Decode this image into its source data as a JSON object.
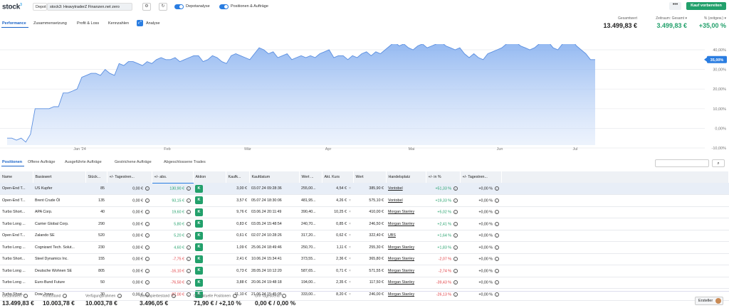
{
  "header": {
    "logo": "stock",
    "logo_sup": "3",
    "depot_label": "Depot",
    "depot_value": "stock3: HeavytraderZ Finanzen.net zero",
    "toggle_depotanalyse": "Depotanalyse",
    "toggle_positionen": "Positionen & Aufträge",
    "more_label": "•••",
    "buy_label": "Kauf vorbereiten"
  },
  "tabs": [
    {
      "label": "Performance",
      "active": true
    },
    {
      "label": "Zusammensetzung",
      "active": false
    },
    {
      "label": "Profit & Loss",
      "active": false
    },
    {
      "label": "Kennzahlen",
      "active": false
    },
    {
      "label": "Analyse",
      "active": false
    }
  ],
  "kpis": {
    "gesamtwert_label": "Gesamtwert",
    "gesamtwert_value": "13.499,83 €",
    "zeitraum_label": "Zeitraum: Gesamt ▾",
    "zeitraum_value": "3.499,83 €",
    "pct_label": "% (zeitgew.) ▾",
    "pct_value": "+35,00 %"
  },
  "chart_data": {
    "type": "area",
    "x_labels": [
      "Jan '24",
      "Feb",
      "Mär",
      "Apr",
      "Mai",
      "Jun",
      "Jul"
    ],
    "y_ticks": [
      "40,00%",
      "30,00%",
      "20,00%",
      "10,00%",
      "0,00%",
      "-10,00%"
    ],
    "ylim": [
      -10,
      40
    ],
    "current_label": "35,00%",
    "accent": "#2a7de1",
    "values": [
      -5,
      -5,
      -6,
      -5,
      -7,
      -3,
      10,
      10,
      10,
      10,
      11,
      11,
      18,
      18,
      19,
      20,
      26,
      27,
      28,
      28,
      27,
      30,
      28,
      27,
      33,
      32,
      34,
      34,
      33,
      32,
      34,
      33,
      35,
      36,
      35,
      35,
      36,
      34,
      35,
      36,
      37,
      37,
      34,
      35,
      37,
      36,
      34,
      33,
      37,
      38,
      37,
      36,
      35,
      38,
      41,
      40,
      38,
      39,
      36,
      37,
      38,
      35,
      36,
      37,
      36,
      37,
      36,
      38,
      39,
      40,
      36,
      37,
      37,
      35,
      37,
      36,
      38,
      39,
      37,
      39,
      38,
      40,
      42,
      44,
      42,
      43,
      41,
      40,
      42,
      43,
      41,
      42,
      43,
      44,
      42,
      41,
      40,
      41,
      38,
      36,
      38,
      36,
      35,
      38,
      39,
      40,
      41,
      43,
      45,
      44,
      42,
      41,
      40,
      41,
      43,
      46,
      44,
      41,
      40,
      43,
      44,
      45,
      42,
      40,
      38,
      35,
      35
    ]
  },
  "tabs2": [
    {
      "label": "Positionen",
      "active": true
    },
    {
      "label": "Offene Aufträge",
      "active": false
    },
    {
      "label": "Ausgeführte Aufträge",
      "active": false
    },
    {
      "label": "Gestrichene Aufträge",
      "active": false
    },
    {
      "label": "Abgeschlossene Trades",
      "active": false
    }
  ],
  "search_icon": "search-icon",
  "table": {
    "headers": [
      "Name",
      "Basiswert",
      "Stück...",
      "+/- Tagestren...",
      "+/- abs.",
      "Aktion",
      "Kaufk...",
      "Kaufdatum",
      "Wert ...",
      "Akt. Kurs",
      "Wert",
      "Handelsplatz",
      "+/- in %",
      "+/- Tagestren..."
    ],
    "rows": [
      {
        "name": "Open-End T...",
        "base": "US Kupfer",
        "qty": "85",
        "tag": "0,00 €",
        "abs": "130,90 €",
        "abs_pos": true,
        "kauf": "3,00 €",
        "datum": "03.07.24 09:28:36",
        "wert1": "255,00...",
        "kurs": "4,54 €",
        "wert": "385,90 €",
        "platz": "Vontobel",
        "pct": "+51,33 %",
        "pct_pos": true,
        "tag2": "+0,00 %"
      },
      {
        "name": "Open-End T...",
        "base": "Brent Crude Öl",
        "qty": "135",
        "tag": "0,00 €",
        "abs": "93,15 €",
        "abs_pos": true,
        "kauf": "3,57 €",
        "datum": "05.07.24 18:30:06",
        "wert1": "481,95...",
        "kurs": "4,26 €",
        "wert": "575,10 €",
        "platz": "Vontobel",
        "pct": "+19,33 %",
        "pct_pos": true,
        "tag2": "+0,00 %"
      },
      {
        "name": "Turbo Short...",
        "base": "APA Corp.",
        "qty": "40",
        "tag": "0,00 €",
        "abs": "19,60 €",
        "abs_pos": true,
        "kauf": "9,76 €",
        "datum": "03.06.24 20:11:49",
        "wert1": "390,40...",
        "kurs": "10,25 €",
        "wert": "410,00 €",
        "platz": "Morgan Stanley",
        "pct": "+5,02 %",
        "pct_pos": true,
        "tag2": "+0,00 %"
      },
      {
        "name": "Turbo Long ...",
        "base": "Carrier Global Corp.",
        "qty": "290",
        "tag": "0,00 €",
        "abs": "5,80 €",
        "abs_pos": true,
        "kauf": "0,83 €",
        "datum": "03.05.24 15:48:54",
        "wert1": "240,70...",
        "kurs": "0,85 €",
        "wert": "246,50 €",
        "platz": "Morgan Stanley",
        "pct": "+2,41 %",
        "pct_pos": true,
        "tag2": "+0,00 %"
      },
      {
        "name": "Open End T...",
        "base": "Zalando SE",
        "qty": "520",
        "tag": "0,00 €",
        "abs": "5,20 €",
        "abs_pos": true,
        "kauf": "0,61 €",
        "datum": "02.07.24 10:28:26",
        "wert1": "317,20...",
        "kurs": "0,62 €",
        "wert": "322,40 €",
        "platz": "UBS",
        "pct": "+1,64 %",
        "pct_pos": true,
        "tag2": "+0,00 %"
      },
      {
        "name": "Turbo Long ...",
        "base": "Cognizant Tech. Solut...",
        "qty": "230",
        "tag": "0,00 €",
        "abs": "4,60 €",
        "abs_pos": true,
        "kauf": "1,09 €",
        "datum": "25.06.24 18:49:46",
        "wert1": "250,70...",
        "kurs": "1,11 €",
        "wert": "255,30 €",
        "platz": "Morgan Stanley",
        "pct": "+1,83 %",
        "pct_pos": true,
        "tag2": "+0,00 %"
      },
      {
        "name": "Turbo Short...",
        "base": "Steel Dynamics Inc.",
        "qty": "155",
        "tag": "0,00 €",
        "abs": "-7,75 €",
        "abs_pos": false,
        "kauf": "2,41 €",
        "datum": "10.06.24 15:34:41",
        "wert1": "373,55...",
        "kurs": "2,36 €",
        "wert": "365,80 €",
        "platz": "Morgan Stanley",
        "pct": "-2,07 %",
        "pct_pos": false,
        "tag2": "+0,00 %"
      },
      {
        "name": "Turbo Long ...",
        "base": "Deutsche Wohnen SE",
        "qty": "805",
        "tag": "0,00 €",
        "abs": "-16,10 €",
        "abs_pos": false,
        "kauf": "0,73 €",
        "datum": "28.05.24 10:12:20",
        "wert1": "587,65...",
        "kurs": "0,71 €",
        "wert": "571,55 €",
        "platz": "Morgan Stanley",
        "pct": "-2,74 %",
        "pct_pos": false,
        "tag2": "+0,00 %"
      },
      {
        "name": "Turbo Long ...",
        "base": "Euro-Bund Future",
        "qty": "50",
        "tag": "0,00 €",
        "abs": "-76,50 €",
        "abs_pos": false,
        "kauf": "3,88 €",
        "datum": "20.06.24 19:48:18",
        "wert1": "194,00...",
        "kurs": "2,35 €",
        "wert": "117,50 €",
        "platz": "Morgan Stanley",
        "pct": "-39,43 %",
        "pct_pos": false,
        "tag2": "+0,00 %"
      },
      {
        "name": "Turbo Short...",
        "base": "Dow Jones",
        "qty": "30",
        "tag": "0,00 €",
        "abs": "-87,00 €",
        "abs_pos": false,
        "kauf": "11,10 €",
        "datum": "21.06.24 15:45:05",
        "wert1": "333,00...",
        "kurs": "8,20 €",
        "wert": "246,00 €",
        "platz": "Morgan Stanley",
        "pct": "-26,13 %",
        "pct_pos": false,
        "tag2": "+0,00 %"
      }
    ],
    "action_label": "K"
  },
  "footer": {
    "items": [
      {
        "label": "Gesamtwert",
        "value": "13.499,83 €"
      },
      {
        "label": "Kontostand",
        "value": "10.003,78 €"
      },
      {
        "label": "Verfügungsrahmen",
        "value": "10.003,78 €"
      },
      {
        "label": "Wertpapierbestand",
        "value": "3.496,05 €"
      },
      {
        "label": "G/V aktuelle Positionen",
        "value": "71,90 € / +2,10 %"
      },
      {
        "label": "G/V Tagestrend",
        "value": "0,00 € / 0,00 %"
      }
    ],
    "ersteller": "Ersteller"
  }
}
